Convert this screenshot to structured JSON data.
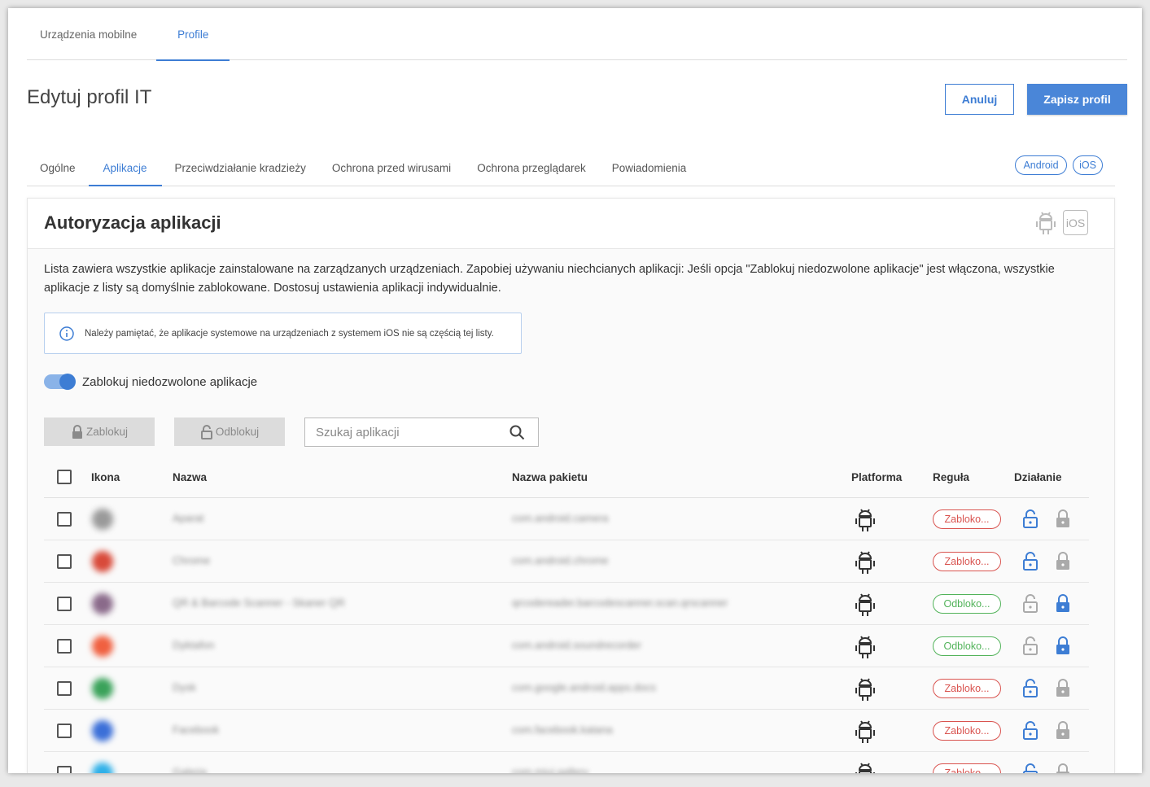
{
  "top_tabs": [
    {
      "label": "Urządzenia mobilne"
    },
    {
      "label": "Profile"
    }
  ],
  "page_title": "Edytuj profil IT",
  "actions": {
    "cancel": "Anuluj",
    "save": "Zapisz profil"
  },
  "section_tabs": [
    {
      "label": "Ogólne"
    },
    {
      "label": "Aplikacje"
    },
    {
      "label": "Przeciwdziałanie kradzieży"
    },
    {
      "label": "Ochrona przed wirusami"
    },
    {
      "label": "Ochrona przeglądarek"
    },
    {
      "label": "Powiadomienia"
    }
  ],
  "platform_pills": {
    "android": "Android",
    "ios": "iOS"
  },
  "card": {
    "title": "Autoryzacja aplikacji",
    "ios_badge": "iOS",
    "description": "Lista zawiera wszystkie aplikacje zainstalowane na zarządzanych urządzeniach. Zapobiej używaniu niechcianych aplikacji: Jeśli opcja \"Zablokuj niedozwolone aplikacje\" jest włączona, wszystkie aplikacje z listy są domyślnie zablokowane. Dostosuj ustawienia aplikacji indywidualnie.",
    "info": "Należy pamiętać, że aplikacje systemowe na urządzeniach z systemem iOS nie są częścią tej listy.",
    "toggle_label": "Zablokuj niedozwolone aplikacje",
    "toggle_on": true,
    "btn_block": "Zablokuj",
    "btn_unblock": "Odblokuj",
    "search_placeholder": "Szukaj aplikacji"
  },
  "table": {
    "headers": {
      "icon": "Ikona",
      "name": "Nazwa",
      "package": "Nazwa pakietu",
      "platform": "Platforma",
      "rule": "Reguła",
      "action": "Działanie"
    },
    "rows": [
      {
        "name": "Aparat",
        "package": "com.android.camera",
        "rule": "Zabloko...",
        "status": "block",
        "icon_color": "#9a9a9a"
      },
      {
        "name": "Chrome",
        "package": "com.android.chrome",
        "rule": "Zabloko...",
        "status": "block",
        "icon_color": "#d84a3a"
      },
      {
        "name": "QR & Barcode Scanner - Skaner QR",
        "package": "qrcodereader.barcodescanner.scan.qrscanner",
        "rule": "Odbloko...",
        "status": "unblock",
        "icon_color": "#8a6a8a"
      },
      {
        "name": "Dyktafon",
        "package": "com.android.soundrecorder",
        "rule": "Odbloko...",
        "status": "unblock",
        "icon_color": "#f06040"
      },
      {
        "name": "Dysk",
        "package": "com.google.android.apps.docs",
        "rule": "Zabloko...",
        "status": "block",
        "icon_color": "#3aa25a"
      },
      {
        "name": "Facebook",
        "package": "com.facebook.katana",
        "rule": "Zabloko...",
        "status": "block",
        "icon_color": "#3b6fd8"
      },
      {
        "name": "Galeria",
        "package": "com.miui.gallery",
        "rule": "Zabloko...",
        "status": "block",
        "icon_color": "#30b0e8"
      }
    ]
  },
  "colors": {
    "accent": "#3d7dd4",
    "blocked": "#d9534f",
    "unblocked": "#52b35a"
  }
}
